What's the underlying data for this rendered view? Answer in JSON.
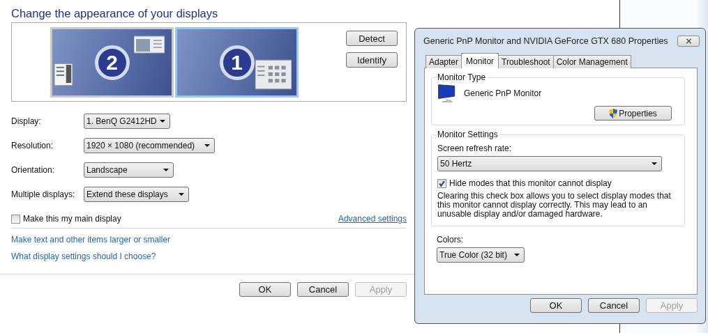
{
  "page": {
    "title": "Change the appearance of your displays",
    "monitors": [
      {
        "number": "2",
        "selected": false
      },
      {
        "number": "1",
        "selected": true
      }
    ],
    "side_buttons": [
      "Detect",
      "Identify"
    ],
    "settings": [
      {
        "label": "Display:",
        "value": "1. BenQ G2412HD"
      },
      {
        "label": "Resolution:",
        "value": "1920 × 1080 (recommended)"
      },
      {
        "label": "Orientation:",
        "value": "Landscape"
      },
      {
        "label": "Multiple displays:",
        "value": "Extend these displays"
      }
    ],
    "main_display": {
      "label": "Make this my main display",
      "checked": false
    },
    "advanced_link": "Advanced settings",
    "links": [
      "Make text and other items larger or smaller",
      "What display settings should I choose?"
    ],
    "buttons": [
      {
        "label": "OK",
        "disabled": false
      },
      {
        "label": "Cancel",
        "disabled": false
      },
      {
        "label": "Apply",
        "disabled": true
      }
    ]
  },
  "dialog": {
    "title": "Generic PnP Monitor and NVIDIA GeForce GTX 680 Properties",
    "tabs": [
      {
        "label": "Adapter",
        "selected": false
      },
      {
        "label": "Monitor",
        "selected": true
      },
      {
        "label": "Troubleshoot",
        "selected": false
      },
      {
        "label": "Color Management",
        "selected": false
      }
    ],
    "monitor_type": {
      "legend": "Monitor Type",
      "name": "Generic PnP Monitor",
      "button": "Properties"
    },
    "monitor_settings": {
      "legend": "Monitor Settings",
      "refresh_label": "Screen refresh rate:",
      "refresh_value": "50 Hertz",
      "hide_modes": {
        "label": "Hide modes that this monitor cannot display",
        "checked": true
      },
      "note": "Clearing this check box allows you to select display modes that this monitor cannot display correctly. This may lead to an unusable display and/or damaged hardware."
    },
    "colors": {
      "label": "Colors:",
      "value": "True Color (32 bit)"
    },
    "buttons": [
      {
        "label": "OK",
        "disabled": false
      },
      {
        "label": "Cancel",
        "disabled": false
      },
      {
        "label": "Apply",
        "disabled": true
      }
    ]
  }
}
